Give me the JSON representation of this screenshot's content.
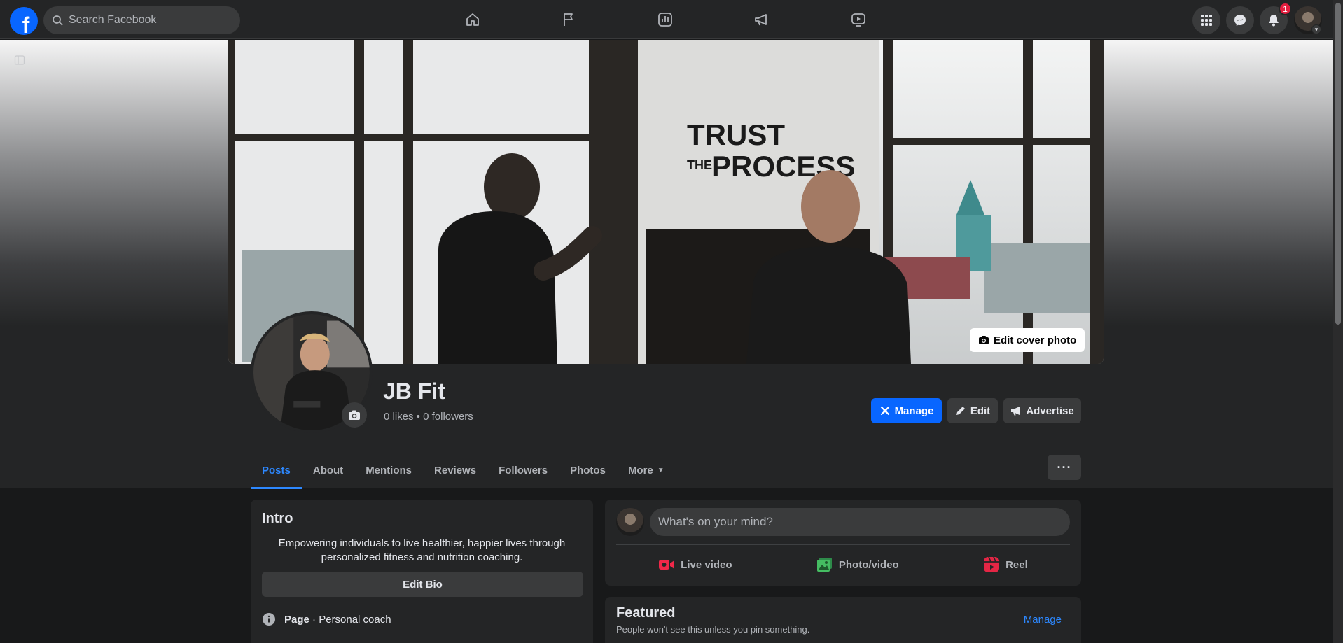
{
  "topbar": {
    "logo_letter": "f",
    "search_placeholder": "Search Facebook",
    "nav_icons": [
      "home-icon",
      "flag-icon",
      "insights-icon",
      "megaphone-icon",
      "video-icon"
    ],
    "notification_count": "1"
  },
  "profile": {
    "name": "JB Fit",
    "stats": "0 likes • 0 followers",
    "edit_cover_label": "Edit cover photo",
    "cover_text_line1": "TRUST",
    "cover_text_the": "THE",
    "cover_text_line2": "PROCESS"
  },
  "actions": {
    "manage": "Manage",
    "edit": "Edit",
    "advertise": "Advertise"
  },
  "tabs": [
    "Posts",
    "About",
    "Mentions",
    "Reviews",
    "Followers",
    "Photos",
    "More"
  ],
  "more_dots": "···",
  "intro": {
    "title": "Intro",
    "bio": "Empowering individuals to live healthier, happier lives through personalized fitness and nutrition coaching.",
    "edit_bio_label": "Edit Bio",
    "category_label": "Page",
    "category_value": " · Personal coach"
  },
  "composer": {
    "placeholder": "What's on your mind?",
    "live_video": "Live video",
    "photo_video": "Photo/video",
    "reel": "Reel"
  },
  "featured": {
    "title": "Featured",
    "subtitle": "People won't see this unless you pin something.",
    "manage": "Manage"
  },
  "colors": {
    "accent": "#0866ff",
    "link": "#2d88ff",
    "surface": "#242526",
    "background": "#18191a",
    "badge": "#e41e3f",
    "live": "#f02849",
    "photo": "#45bd62",
    "reel": "#e42645"
  }
}
